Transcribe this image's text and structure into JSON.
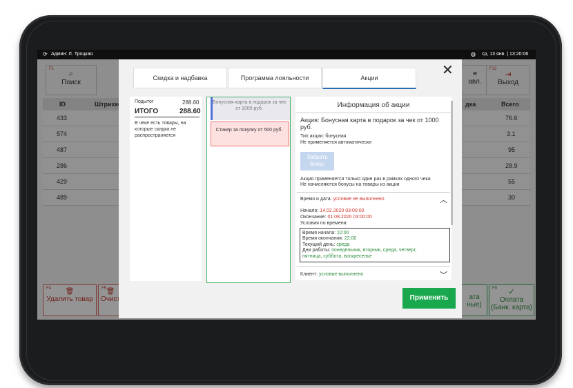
{
  "status_bar": {
    "user": "Админ: Л. Троцкая",
    "date_time": "ср, 13 янв.  |  13:20:06",
    "sync_icon": "sync-icon",
    "globe_icon": "globe-icon"
  },
  "background": {
    "search_fkey": "F1",
    "search_label": "Поиск",
    "exit_fkey": "F12",
    "exit_label": "Выход",
    "partial_label": "авл.",
    "columns": {
      "id": "ID",
      "barcode": "Штрихкод",
      "discount": "дка",
      "total": "Всего"
    },
    "rows": [
      {
        "id": "433",
        "total": "76.6"
      },
      {
        "id": "574",
        "total": "3.1"
      },
      {
        "id": "487",
        "total": "95"
      },
      {
        "id": "286",
        "total": "28.9"
      },
      {
        "id": "429",
        "total": "55"
      },
      {
        "id": "489",
        "total": "30"
      }
    ],
    "delete_fkey": "F4",
    "delete_label": "Удалить товар",
    "clear_fkey": "F5",
    "clear_label": "Очист",
    "card_pay_fkey": "F9",
    "card_pay_label": "Оплата (Банк. карта)",
    "partial_pay_label1": "ата",
    "partial_pay_label2": "ные)"
  },
  "modal": {
    "tabs": [
      "Скидка и надбавка",
      "Программа лояльности",
      "Акции"
    ],
    "active_tab": "Акции",
    "receipt": {
      "subtotal_label": "Подытог",
      "subtotal_value": "288.60",
      "total_label": "ИТОГО",
      "total_value": "288.60",
      "note": "В чеке есть товары, на которые скидка не распространяется"
    },
    "promos": [
      "Бонусная карта в подарок за чек от 1000 руб.",
      "Стикер за покупку от 500 руб."
    ],
    "info": {
      "title": "Информация об акции",
      "promo_name": "Акция: Бонусная карта в подарок за чек от 1000 руб.",
      "type": "Тип акции: бонусная",
      "auto": "Не применяется автоматически",
      "take_bonus": "Забрать бонус",
      "rule1": "Акция применяется только один раз в рамках одного чека",
      "rule2": "Не начисляются бонусы на товары из акции",
      "datetime_label": "Время и дата:",
      "datetime_status": "условие не выполнено",
      "start_label": "Начало:",
      "start_value": "14.02.2020 03:00:00",
      "end_label": "Окончание:",
      "end_value": "01.08.2020 03:00:00",
      "time_conditions": "Условия по времени:",
      "start_time_label": "Время начала:",
      "start_time_value": "10:00",
      "end_time_label": "Время окончания:",
      "end_time_value": "22:00",
      "current_day_label": "Текущий день:",
      "current_day_value": "среда",
      "workdays_label": "Дни работы:",
      "workdays_value1": "понедельник, вторник, среда, четверг,",
      "workdays_value2": "пятница, суббота, воскресенье",
      "client_label": "Клиент:",
      "client_status": "условие выполнено"
    },
    "apply": "Применить"
  }
}
